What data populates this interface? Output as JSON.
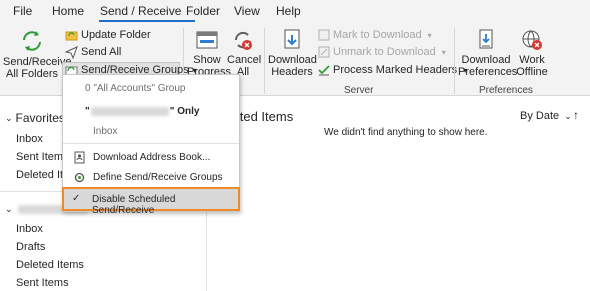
{
  "tabs": [
    {
      "label": "File"
    },
    {
      "label": "Home"
    },
    {
      "label": "Send / Receive"
    },
    {
      "label": "Folder"
    },
    {
      "label": "View"
    },
    {
      "label": "Help"
    }
  ],
  "ribbon": {
    "send_receive_all": "Send/Receive All Folders",
    "update_folder": "Update Folder",
    "send_all": "Send All",
    "send_receive_groups": "Send/Receive Groups",
    "show_progress": "Show Progress",
    "cancel_all": "Cancel All",
    "download_headers": "Download Headers",
    "mark_to_download": "Mark to Download",
    "unmark_to_download": "Unmark to Download",
    "process_marked_headers": "Process Marked Headers",
    "group_server": "Server",
    "download_preferences": "Download Preferences",
    "work_offline": "Work Offline",
    "group_preferences": "Preferences",
    "group_s": "S",
    "group_d": "d"
  },
  "menu": {
    "all_accounts": "0 \"All Accounts\" Group",
    "only_suffix": "\" Only",
    "only_prefix": "\"",
    "inbox": "Inbox",
    "download_address_book": "Download Address Book...",
    "define_groups": "Define Send/Receive Groups",
    "disable_scheduled": "Disable Scheduled Send/Receive"
  },
  "nav": {
    "favorites": "Favorites",
    "fav_items": [
      "Inbox",
      "Sent Items",
      "Deleted Items"
    ],
    "account_items": [
      "Inbox",
      "Drafts",
      "Deleted Items",
      "Sent Items"
    ]
  },
  "main": {
    "title": "ected Items",
    "sort_label": "By Date",
    "empty_message": "We didn't find anything to show here."
  },
  "colors": {
    "accent": "#1e6fc9",
    "highlight_border": "#ef8a29"
  }
}
